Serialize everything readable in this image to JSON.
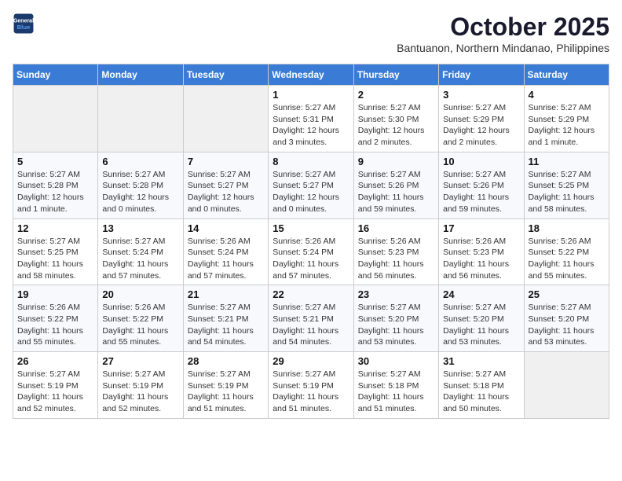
{
  "header": {
    "logo_line1": "General",
    "logo_line2": "Blue",
    "month": "October 2025",
    "location": "Bantuanon, Northern Mindanao, Philippines"
  },
  "days_of_week": [
    "Sunday",
    "Monday",
    "Tuesday",
    "Wednesday",
    "Thursday",
    "Friday",
    "Saturday"
  ],
  "weeks": [
    [
      {
        "day": "",
        "info": ""
      },
      {
        "day": "",
        "info": ""
      },
      {
        "day": "",
        "info": ""
      },
      {
        "day": "1",
        "info": "Sunrise: 5:27 AM\nSunset: 5:31 PM\nDaylight: 12 hours and 3 minutes."
      },
      {
        "day": "2",
        "info": "Sunrise: 5:27 AM\nSunset: 5:30 PM\nDaylight: 12 hours and 2 minutes."
      },
      {
        "day": "3",
        "info": "Sunrise: 5:27 AM\nSunset: 5:29 PM\nDaylight: 12 hours and 2 minutes."
      },
      {
        "day": "4",
        "info": "Sunrise: 5:27 AM\nSunset: 5:29 PM\nDaylight: 12 hours and 1 minute."
      }
    ],
    [
      {
        "day": "5",
        "info": "Sunrise: 5:27 AM\nSunset: 5:28 PM\nDaylight: 12 hours and 1 minute."
      },
      {
        "day": "6",
        "info": "Sunrise: 5:27 AM\nSunset: 5:28 PM\nDaylight: 12 hours and 0 minutes."
      },
      {
        "day": "7",
        "info": "Sunrise: 5:27 AM\nSunset: 5:27 PM\nDaylight: 12 hours and 0 minutes."
      },
      {
        "day": "8",
        "info": "Sunrise: 5:27 AM\nSunset: 5:27 PM\nDaylight: 12 hours and 0 minutes."
      },
      {
        "day": "9",
        "info": "Sunrise: 5:27 AM\nSunset: 5:26 PM\nDaylight: 11 hours and 59 minutes."
      },
      {
        "day": "10",
        "info": "Sunrise: 5:27 AM\nSunset: 5:26 PM\nDaylight: 11 hours and 59 minutes."
      },
      {
        "day": "11",
        "info": "Sunrise: 5:27 AM\nSunset: 5:25 PM\nDaylight: 11 hours and 58 minutes."
      }
    ],
    [
      {
        "day": "12",
        "info": "Sunrise: 5:27 AM\nSunset: 5:25 PM\nDaylight: 11 hours and 58 minutes."
      },
      {
        "day": "13",
        "info": "Sunrise: 5:27 AM\nSunset: 5:24 PM\nDaylight: 11 hours and 57 minutes."
      },
      {
        "day": "14",
        "info": "Sunrise: 5:26 AM\nSunset: 5:24 PM\nDaylight: 11 hours and 57 minutes."
      },
      {
        "day": "15",
        "info": "Sunrise: 5:26 AM\nSunset: 5:24 PM\nDaylight: 11 hours and 57 minutes."
      },
      {
        "day": "16",
        "info": "Sunrise: 5:26 AM\nSunset: 5:23 PM\nDaylight: 11 hours and 56 minutes."
      },
      {
        "day": "17",
        "info": "Sunrise: 5:26 AM\nSunset: 5:23 PM\nDaylight: 11 hours and 56 minutes."
      },
      {
        "day": "18",
        "info": "Sunrise: 5:26 AM\nSunset: 5:22 PM\nDaylight: 11 hours and 55 minutes."
      }
    ],
    [
      {
        "day": "19",
        "info": "Sunrise: 5:26 AM\nSunset: 5:22 PM\nDaylight: 11 hours and 55 minutes."
      },
      {
        "day": "20",
        "info": "Sunrise: 5:26 AM\nSunset: 5:22 PM\nDaylight: 11 hours and 55 minutes."
      },
      {
        "day": "21",
        "info": "Sunrise: 5:27 AM\nSunset: 5:21 PM\nDaylight: 11 hours and 54 minutes."
      },
      {
        "day": "22",
        "info": "Sunrise: 5:27 AM\nSunset: 5:21 PM\nDaylight: 11 hours and 54 minutes."
      },
      {
        "day": "23",
        "info": "Sunrise: 5:27 AM\nSunset: 5:20 PM\nDaylight: 11 hours and 53 minutes."
      },
      {
        "day": "24",
        "info": "Sunrise: 5:27 AM\nSunset: 5:20 PM\nDaylight: 11 hours and 53 minutes."
      },
      {
        "day": "25",
        "info": "Sunrise: 5:27 AM\nSunset: 5:20 PM\nDaylight: 11 hours and 53 minutes."
      }
    ],
    [
      {
        "day": "26",
        "info": "Sunrise: 5:27 AM\nSunset: 5:19 PM\nDaylight: 11 hours and 52 minutes."
      },
      {
        "day": "27",
        "info": "Sunrise: 5:27 AM\nSunset: 5:19 PM\nDaylight: 11 hours and 52 minutes."
      },
      {
        "day": "28",
        "info": "Sunrise: 5:27 AM\nSunset: 5:19 PM\nDaylight: 11 hours and 51 minutes."
      },
      {
        "day": "29",
        "info": "Sunrise: 5:27 AM\nSunset: 5:19 PM\nDaylight: 11 hours and 51 minutes."
      },
      {
        "day": "30",
        "info": "Sunrise: 5:27 AM\nSunset: 5:18 PM\nDaylight: 11 hours and 51 minutes."
      },
      {
        "day": "31",
        "info": "Sunrise: 5:27 AM\nSunset: 5:18 PM\nDaylight: 11 hours and 50 minutes."
      },
      {
        "day": "",
        "info": ""
      }
    ]
  ]
}
